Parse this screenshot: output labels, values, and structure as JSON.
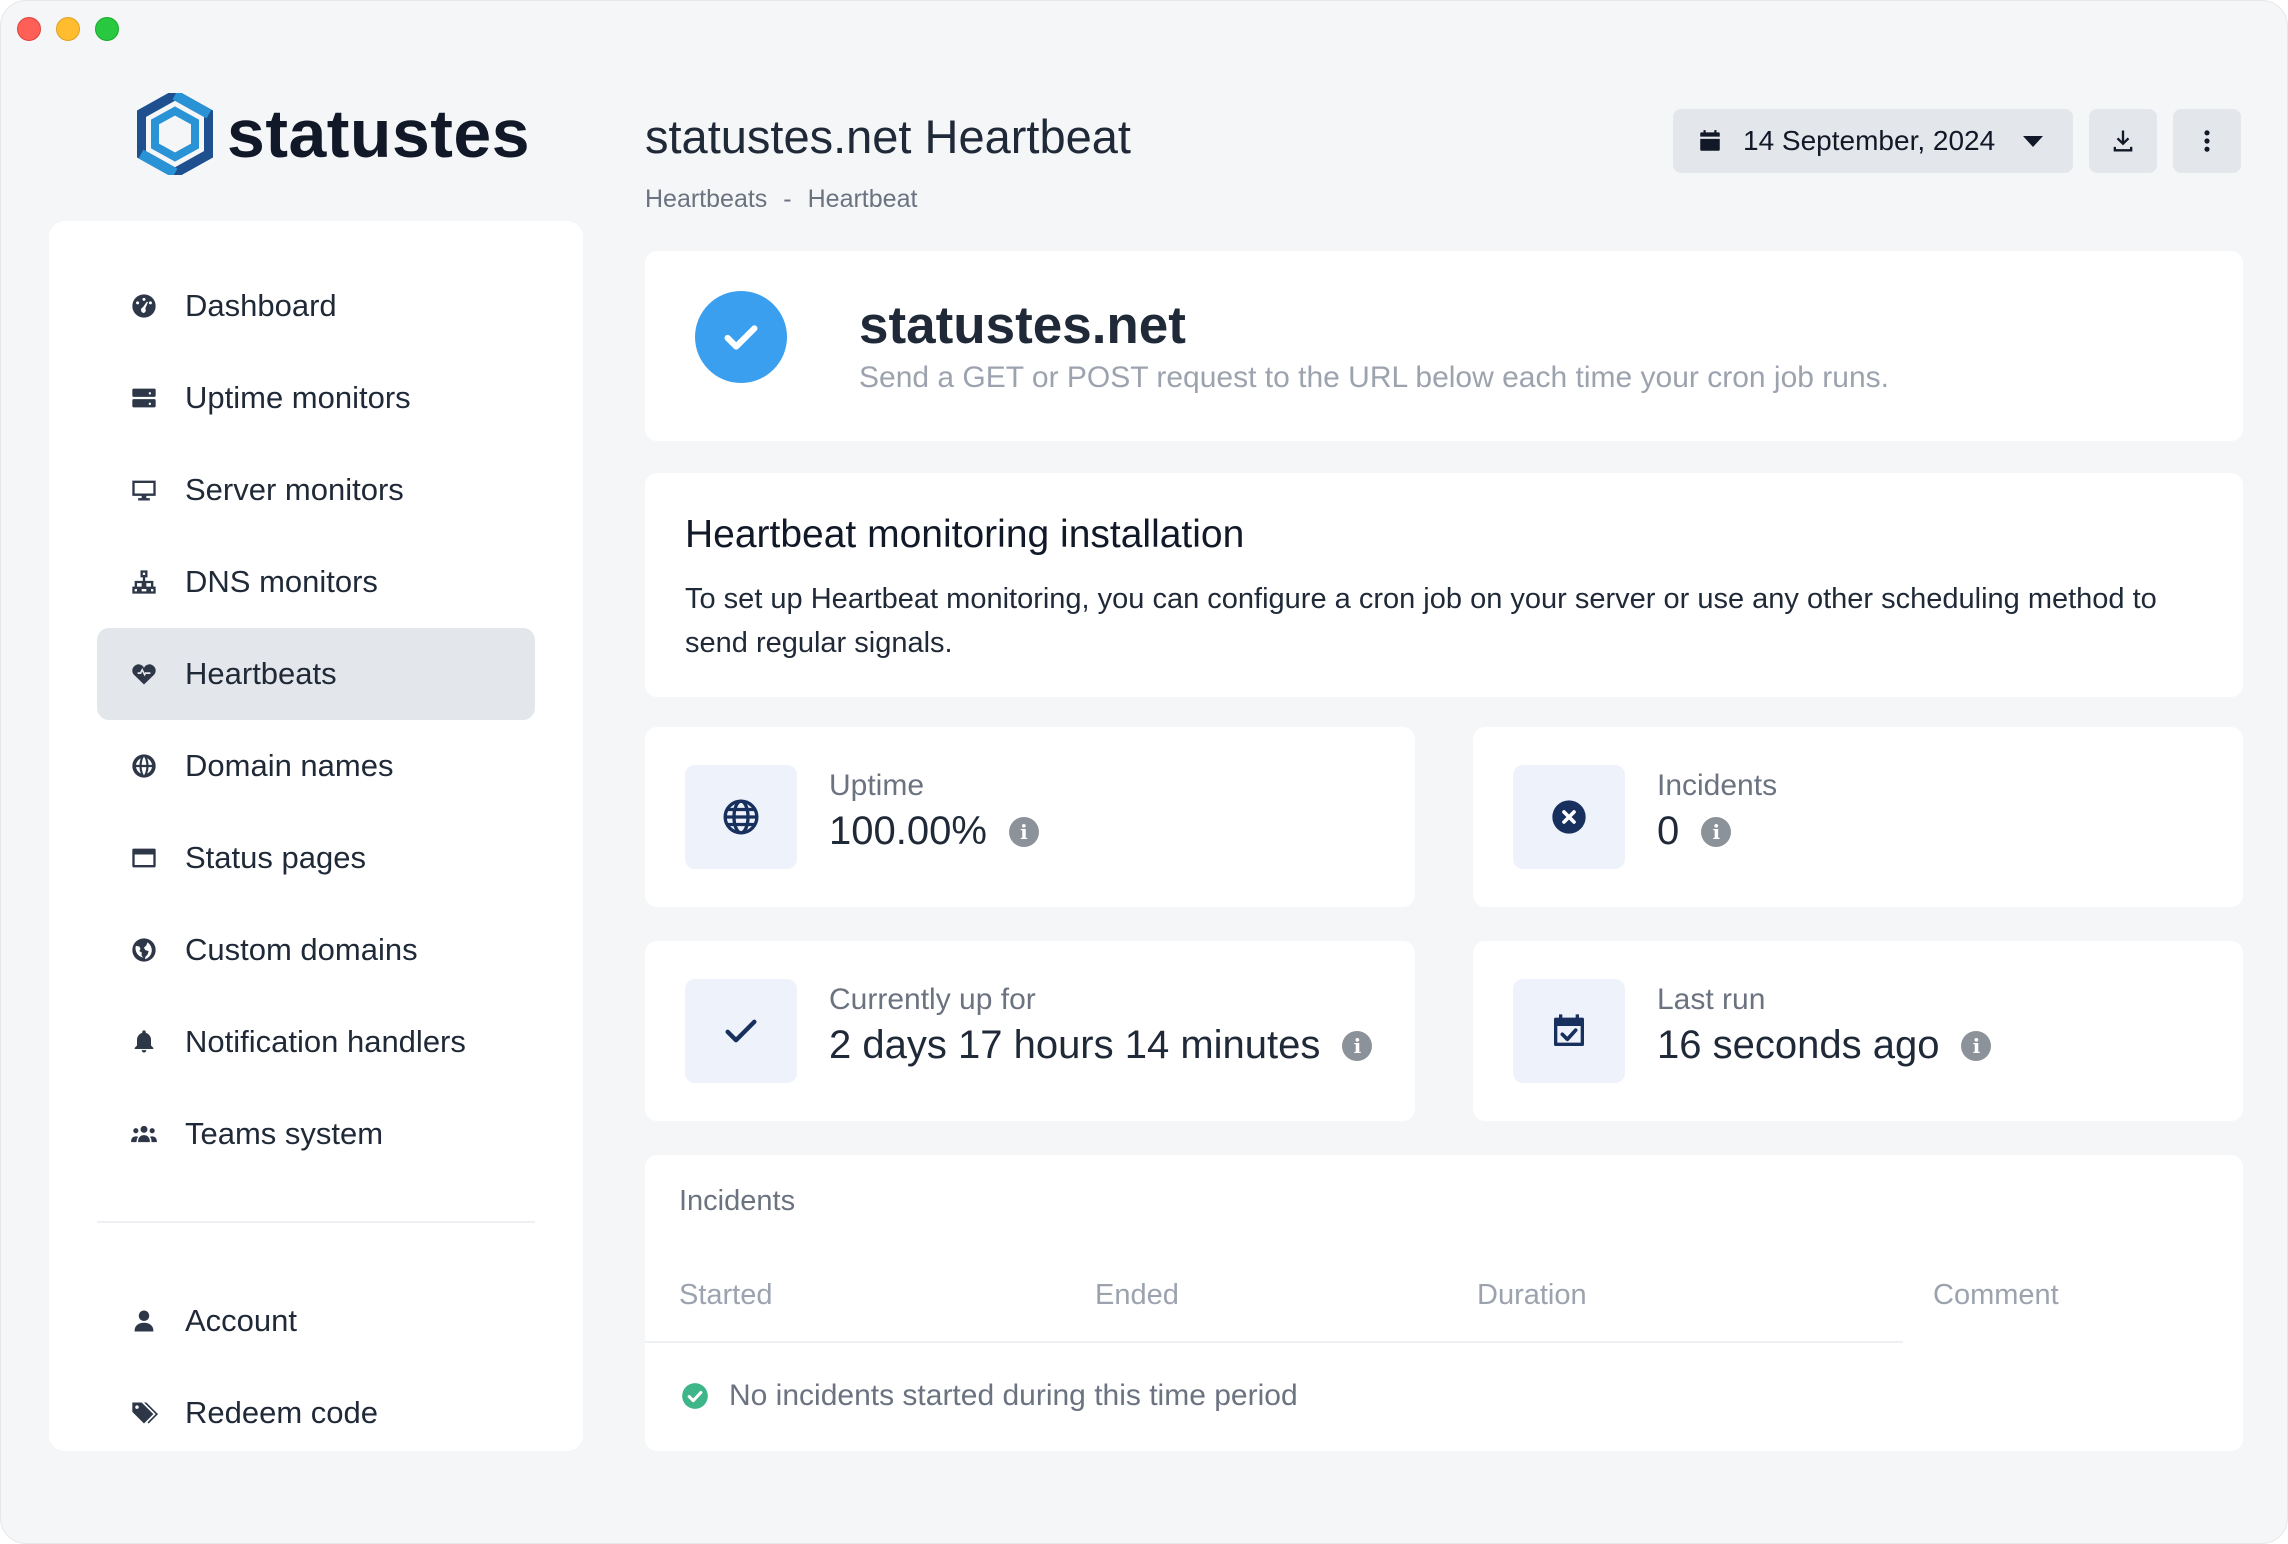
{
  "app": {
    "logo_text": "statustes"
  },
  "header": {
    "title": "statustes.net Heartbeat",
    "breadcrumb": [
      "Heartbeats",
      "-",
      "Heartbeat"
    ],
    "date": "14 September, 2024"
  },
  "sidebar": {
    "items": [
      {
        "label": "Dashboard",
        "icon": "dashboard-icon"
      },
      {
        "label": "Uptime monitors",
        "icon": "server-icon"
      },
      {
        "label": "Server monitors",
        "icon": "desktop-icon"
      },
      {
        "label": "DNS monitors",
        "icon": "network-icon"
      },
      {
        "label": "Heartbeats",
        "icon": "heart-pulse-icon",
        "active": true
      },
      {
        "label": "Domain names",
        "icon": "globe-icon"
      },
      {
        "label": "Status pages",
        "icon": "window-icon"
      },
      {
        "label": "Custom domains",
        "icon": "earth-icon"
      },
      {
        "label": "Notification handlers",
        "icon": "bell-icon"
      },
      {
        "label": "Teams system",
        "icon": "users-icon"
      }
    ],
    "bottom_items": [
      {
        "label": "Account",
        "icon": "user-icon"
      },
      {
        "label": "Redeem code",
        "icon": "tags-icon"
      }
    ]
  },
  "hero": {
    "title": "statustes.net",
    "subtitle": "Send a GET or POST request to the URL below each time your cron job runs."
  },
  "install": {
    "title": "Heartbeat monitoring installation",
    "text": "To set up Heartbeat monitoring, you can configure a cron job on your server or use any other scheduling method to send regular signals."
  },
  "stats": {
    "uptime": {
      "label": "Uptime",
      "value": "100.00%"
    },
    "incidents": {
      "label": "Incidents",
      "value": "0"
    },
    "up_for": {
      "label": "Currently up for",
      "value": "2 days 17 hours 14 minutes"
    },
    "last_run": {
      "label": "Last run",
      "value": "16 seconds ago"
    }
  },
  "incidents_table": {
    "title": "Incidents",
    "columns": [
      "Started",
      "Ended",
      "Duration",
      "Comment"
    ],
    "empty_message": "No incidents started during this time period"
  },
  "colors": {
    "accent_blue": "#3b9ff0",
    "navy": "#17305e",
    "success_green": "#3fb58a",
    "active_bg": "#e3e6ea"
  }
}
